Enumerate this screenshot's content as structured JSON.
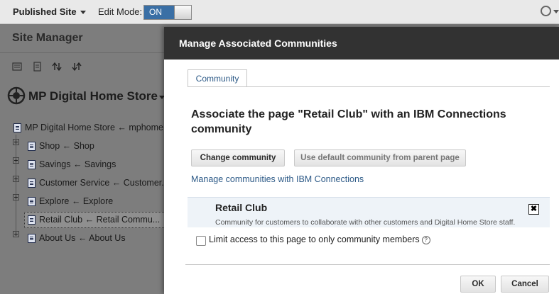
{
  "topbar": {
    "published_label": "Published Site",
    "edit_mode_label": "Edit Mode:",
    "toggle_state": "ON"
  },
  "sidebar": {
    "title": "Site Manager",
    "site_name": "MP Digital Home Store",
    "tree": [
      {
        "label": "MP Digital Home Store ← mphome..."
      },
      {
        "label": "Shop ← Shop"
      },
      {
        "label": "Savings ← Savings"
      },
      {
        "label": "Customer Service ← Customer..."
      },
      {
        "label": "Explore ← Explore"
      },
      {
        "label": "Retail Club ← Retail Commu...",
        "selected": true
      },
      {
        "label": "About Us ← About Us"
      }
    ]
  },
  "modal": {
    "title": "Manage Associated Communities",
    "tab": "Community",
    "heading": "Associate the page \"Retail Club\" with an IBM Connections community",
    "change_button": "Change community",
    "default_button": "Use default community from parent page",
    "manage_link": "Manage communities with IBM Connections",
    "community": {
      "name": "Retail Club",
      "description": "Community for customers to collaborate with other customers and Digital Home Store staff.",
      "remove_symbol": "✖"
    },
    "limit_label": "Limit access to this page to only community members",
    "help_symbol": "?",
    "ok_button": "OK",
    "cancel_button": "Cancel"
  }
}
